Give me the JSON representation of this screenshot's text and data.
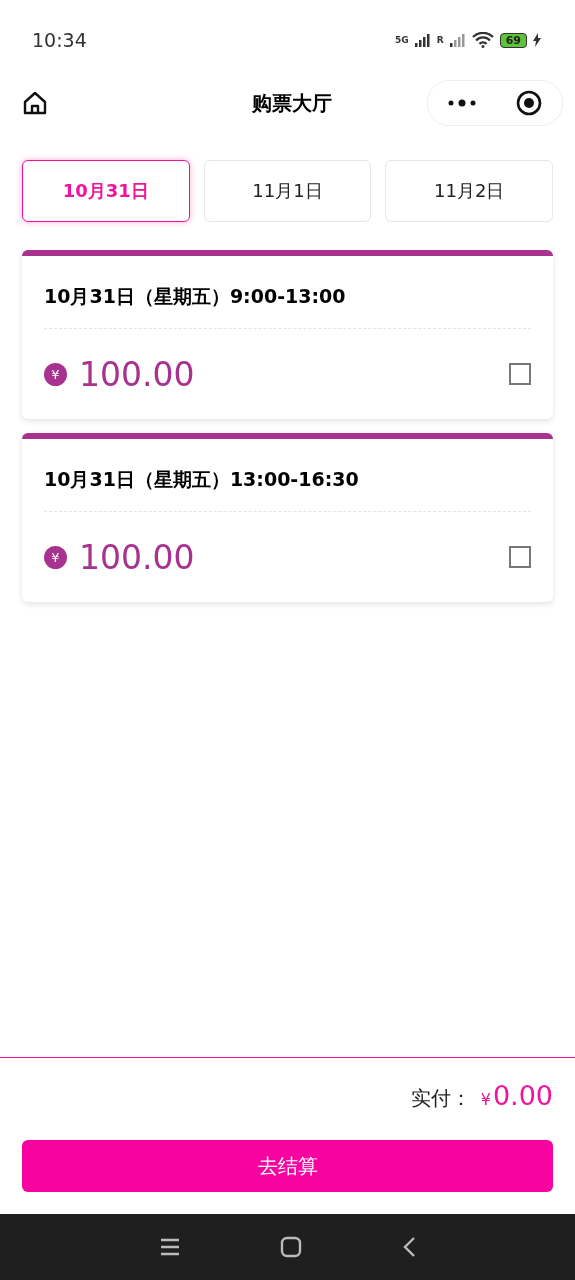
{
  "status_bar": {
    "time": "10:34",
    "network": "5G",
    "sim2": "R",
    "battery": "69"
  },
  "nav": {
    "title": "购票大厅"
  },
  "date_tabs": [
    {
      "label": "10月31日",
      "selected": true
    },
    {
      "label": "11月1日",
      "selected": false
    },
    {
      "label": "11月2日",
      "selected": false
    }
  ],
  "sessions": [
    {
      "title": "10月31日（星期五）9:00-13:00",
      "currency": "¥",
      "price": "100.00",
      "checked": false
    },
    {
      "title": "10月31日（星期五）13:00-16:30",
      "currency": "¥",
      "price": "100.00",
      "checked": false
    }
  ],
  "footer": {
    "total_label": "实付：",
    "currency": "¥",
    "total": "0.00",
    "checkout": "去结算"
  }
}
